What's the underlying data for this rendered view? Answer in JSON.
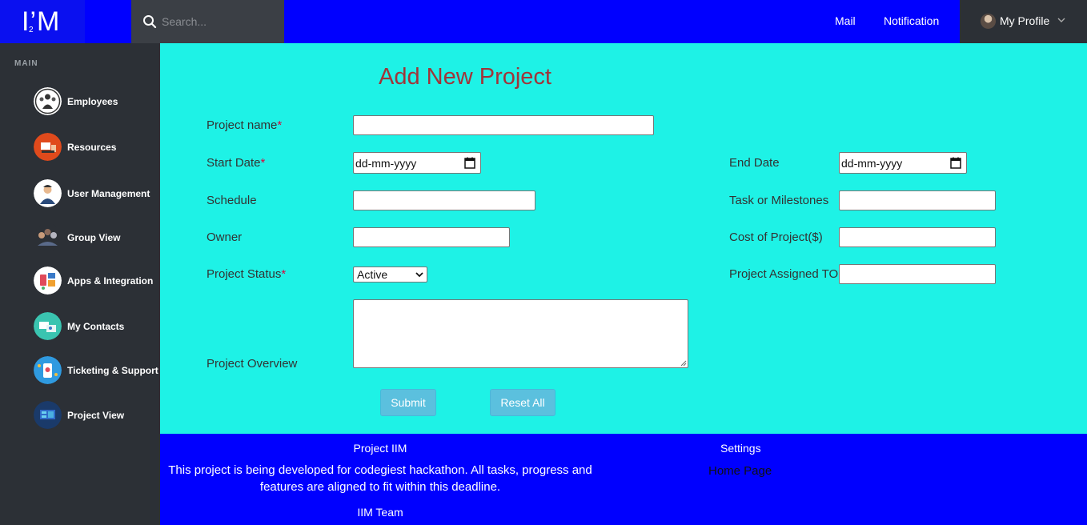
{
  "header": {
    "logo_text": "I’M",
    "logo_sub": "2",
    "search_placeholder": "Search...",
    "mail_label": "Mail",
    "notification_label": "Notification",
    "profile_label": "My Profile"
  },
  "sidebar": {
    "section_label": "MAIN",
    "items": [
      {
        "label": "Employees",
        "icon": "employees-icon"
      },
      {
        "label": "Resources",
        "icon": "resources-icon"
      },
      {
        "label": "User Management",
        "icon": "user-management-icon"
      },
      {
        "label": "Group View",
        "icon": "group-view-icon"
      },
      {
        "label": "Apps & Integration",
        "icon": "apps-integration-icon"
      },
      {
        "label": "My Contacts",
        "icon": "contacts-icon"
      },
      {
        "label": "Ticketing & Support",
        "icon": "ticketing-icon"
      },
      {
        "label": "Project View",
        "icon": "project-view-icon"
      }
    ]
  },
  "form": {
    "title": "Add New Project",
    "project_name_label": "Project name",
    "start_date_label": "Start Date",
    "end_date_label": "End Date",
    "schedule_label": "Schedule",
    "milestones_label": "Task or Milestones",
    "owner_label": "Owner",
    "cost_label": "Cost of Project($)",
    "status_label": "Project Status",
    "assigned_label": "Project Assigned TO",
    "overview_label": "Project Overview",
    "required_mark": "*",
    "date_placeholder": "dd-mm-yyyy",
    "status_value": "Active",
    "submit_label": "Submit",
    "reset_label": "Reset All"
  },
  "footer": {
    "project_title": "Project IIM",
    "description": "This project is being developed for codegiest hackathon. All tasks, progress and features are aligned to fit within this deadline.",
    "team": "IIM Team",
    "settings_label": "Settings",
    "home_link": "Home Page"
  },
  "colors": {
    "header_bg": "#0000ff",
    "content_bg": "#1ef2e6",
    "sidebar_bg": "#2c3036",
    "title_color": "#a0353a",
    "button_bg": "#5bc0de"
  }
}
